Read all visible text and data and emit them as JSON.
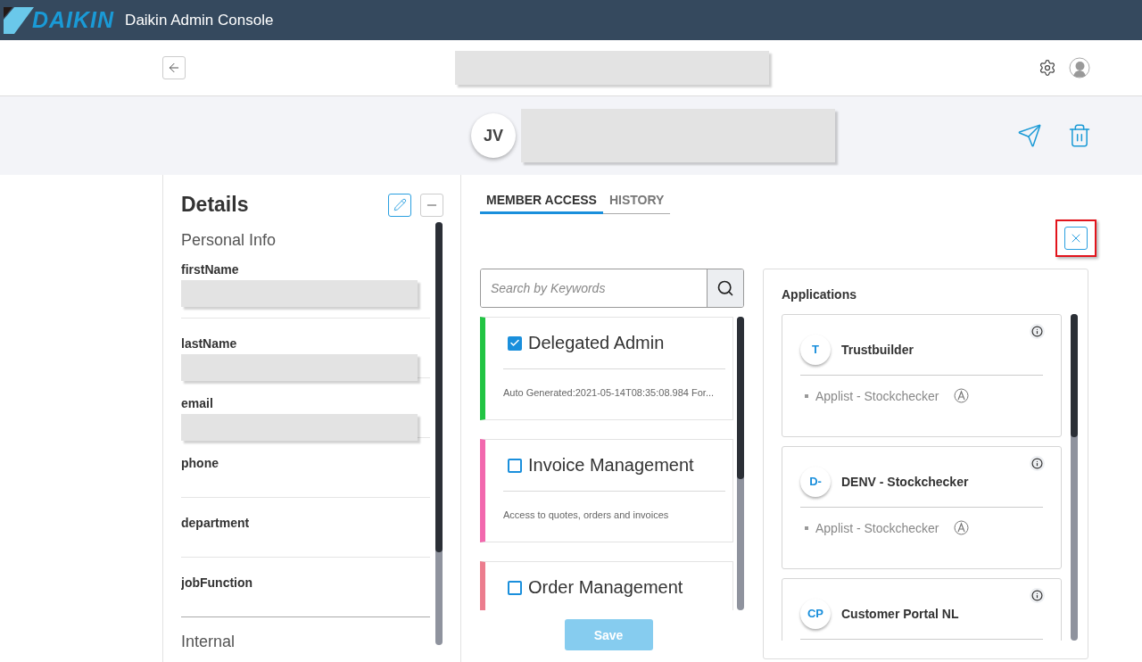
{
  "header": {
    "logo": "DAIKIN",
    "title": "Daikin Admin Console"
  },
  "toolbar": {
    "title_redacted": true
  },
  "profile": {
    "initials": "JV",
    "name_redacted": true
  },
  "details": {
    "title": "Details",
    "section": "Personal Info",
    "fields": [
      {
        "label": "firstName",
        "redacted": true
      },
      {
        "label": "lastName",
        "redacted": true
      },
      {
        "label": "email",
        "redacted": true
      },
      {
        "label": "phone",
        "redacted": false
      },
      {
        "label": "department",
        "redacted": false
      },
      {
        "label": "jobFunction",
        "redacted": false
      }
    ],
    "next_section": "Internal"
  },
  "tabs": [
    {
      "label": "MEMBER ACCESS",
      "selected": true
    },
    {
      "label": "HISTORY",
      "selected": false
    }
  ],
  "search": {
    "placeholder": "Search by Keywords"
  },
  "roles": [
    {
      "name": "Delegated Admin",
      "checked": true,
      "color": "#22c443",
      "description": "Auto Generated:2021-05-14T08:35:08.984 For..."
    },
    {
      "name": "Invoice Management",
      "checked": false,
      "color": "#f268ae",
      "description": "Access to quotes, orders and invoices"
    },
    {
      "name": "Order Management",
      "checked": false,
      "color": "#ec7d8e"
    }
  ],
  "save_button": {
    "label": "Save",
    "disabled": true
  },
  "applications": {
    "title": "Applications",
    "items": [
      {
        "initials": "T",
        "name": "Trustbuilder",
        "sub_items": [
          "Applist - Stockchecker"
        ]
      },
      {
        "initials": "D-",
        "name": "DENV - Stockchecker",
        "sub_items": [
          "Applist - Stockchecker"
        ]
      },
      {
        "initials": "CP",
        "name": "Customer Portal NL"
      }
    ]
  }
}
